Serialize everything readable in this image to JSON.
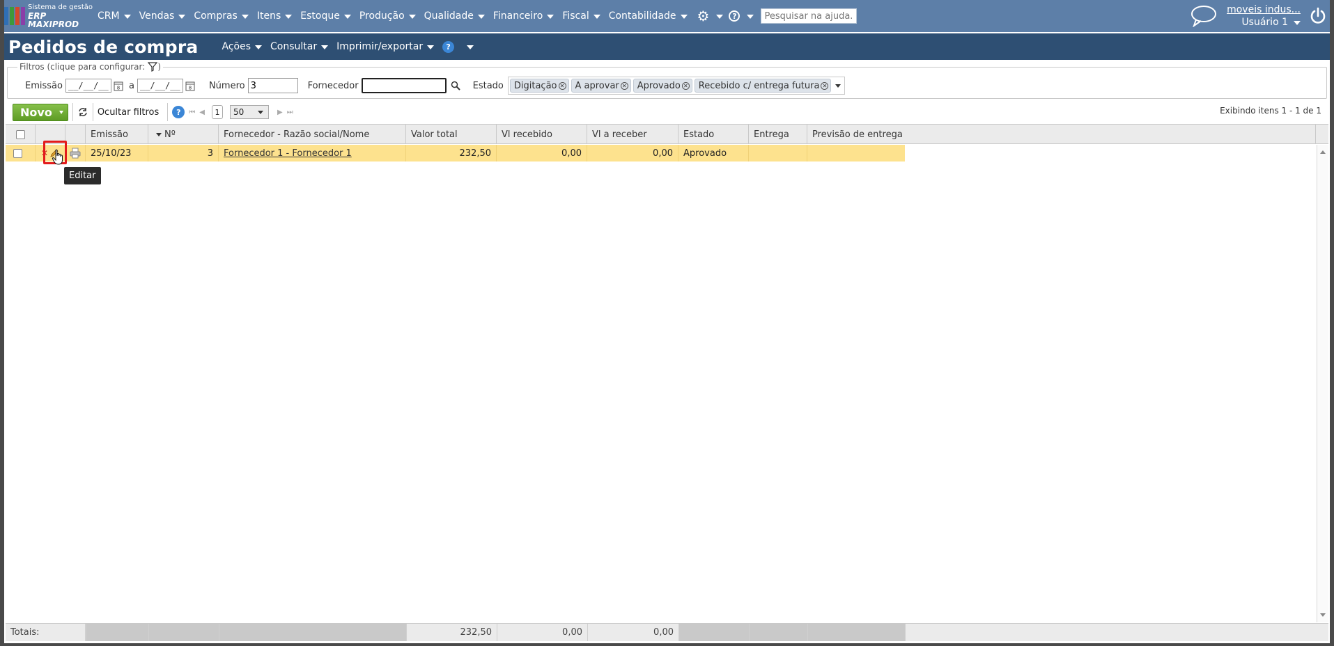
{
  "app": {
    "logo_line1": "Sistema de gestão",
    "logo_line2": "ERP MAXIPROD",
    "logo_colors": [
      "#2f6fb5",
      "#3c9a3a",
      "#d24a2a",
      "#8a3ea8"
    ],
    "menu": [
      {
        "label": "CRM"
      },
      {
        "label": "Vendas"
      },
      {
        "label": "Compras"
      },
      {
        "label": "Itens"
      },
      {
        "label": "Estoque"
      },
      {
        "label": "Produção"
      },
      {
        "label": "Qualidade"
      },
      {
        "label": "Financeiro"
      },
      {
        "label": "Fiscal"
      },
      {
        "label": "Contabilidade"
      }
    ],
    "search_placeholder": "Pesquisar na ajuda...",
    "company": "moveis indus...",
    "user": "Usuário 1"
  },
  "page": {
    "title": "Pedidos de compra",
    "menu": [
      {
        "label": "Ações"
      },
      {
        "label": "Consultar"
      },
      {
        "label": "Imprimir/exportar"
      }
    ],
    "help_glyph": "?"
  },
  "filters": {
    "legend": "Filtros (clique para configurar:",
    "legend_close": ")",
    "emissao_label": "Emissão",
    "date_from": "__/__/__",
    "date_sep": "a",
    "date_to": "__/__/__",
    "numero_label": "Número",
    "numero_value": "3",
    "fornecedor_label": "Fornecedor",
    "fornecedor_value": "",
    "estado_label": "Estado",
    "estado_chips": [
      "Digitação",
      "A aprovar",
      "Aprovado",
      "Recebido c/ entrega futura"
    ]
  },
  "toolbar": {
    "novo_label": "Novo",
    "ocultar_label": "Ocultar filtros",
    "page": "1",
    "page_size": "50",
    "items_info": "Exibindo itens 1 - 1 de 1"
  },
  "grid": {
    "headers": {
      "emissao": "Emissão",
      "numero": "Nº",
      "fornecedor": "Fornecedor - Razão social/Nome",
      "valor_total": "Valor total",
      "vl_recebido": "Vl recebido",
      "vl_a_receber": "Vl a receber",
      "estado": "Estado",
      "entrega": "Entrega",
      "previsao": "Previsão de entrega"
    },
    "rows": [
      {
        "emissao": "25/10/23",
        "numero": "3",
        "fornecedor": "Fornecedor 1 - Fornecedor 1",
        "valor_total": "232,50",
        "vl_recebido": "0,00",
        "vl_a_receber": "0,00",
        "estado": "Aprovado",
        "entrega": "",
        "previsao": ""
      }
    ],
    "totals_label": "Totais:",
    "totals": {
      "valor_total": "232,50",
      "vl_recebido": "0,00",
      "vl_a_receber": "0,00"
    },
    "row_highlight_color": "#fde28e"
  },
  "tooltip": {
    "text": "Editar"
  },
  "colors": {
    "topbar": "#5d7fa8",
    "titlebar": "#2e4f73",
    "novo_button": "#6aa832",
    "highlight": "#e31b1b"
  }
}
